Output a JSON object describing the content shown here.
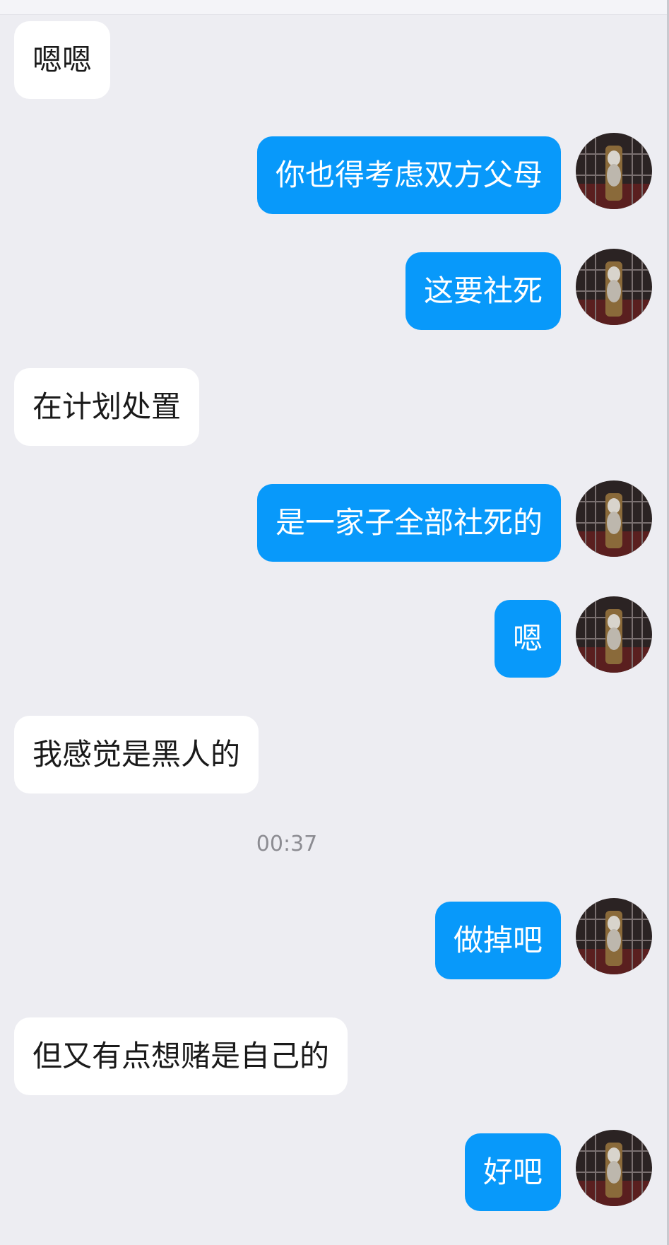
{
  "colors": {
    "background": "#ededf2",
    "incoming_bubble": "#ffffff",
    "outgoing_bubble": "#0899fa",
    "timestamp_text": "#8c8c92"
  },
  "messages": [
    {
      "side": "in",
      "text": "嗯嗯"
    },
    {
      "side": "out",
      "text": "你也得考虑双方父母",
      "avatar": "user-avatar"
    },
    {
      "side": "out",
      "text": "这要社死",
      "avatar": "user-avatar"
    },
    {
      "side": "in",
      "text": "在计划处置"
    },
    {
      "side": "out",
      "text": "是一家子全部社死的",
      "avatar": "user-avatar"
    },
    {
      "side": "out",
      "text": "嗯",
      "avatar": "user-avatar"
    },
    {
      "side": "in",
      "text": "我感觉是黑人的"
    },
    {
      "side": "out",
      "text": "做掉吧",
      "avatar": "user-avatar"
    },
    {
      "side": "in",
      "text": "但又有点想赌是自己的"
    },
    {
      "side": "out",
      "text": "好吧",
      "avatar": "user-avatar"
    }
  ],
  "timestamp": "00:37"
}
